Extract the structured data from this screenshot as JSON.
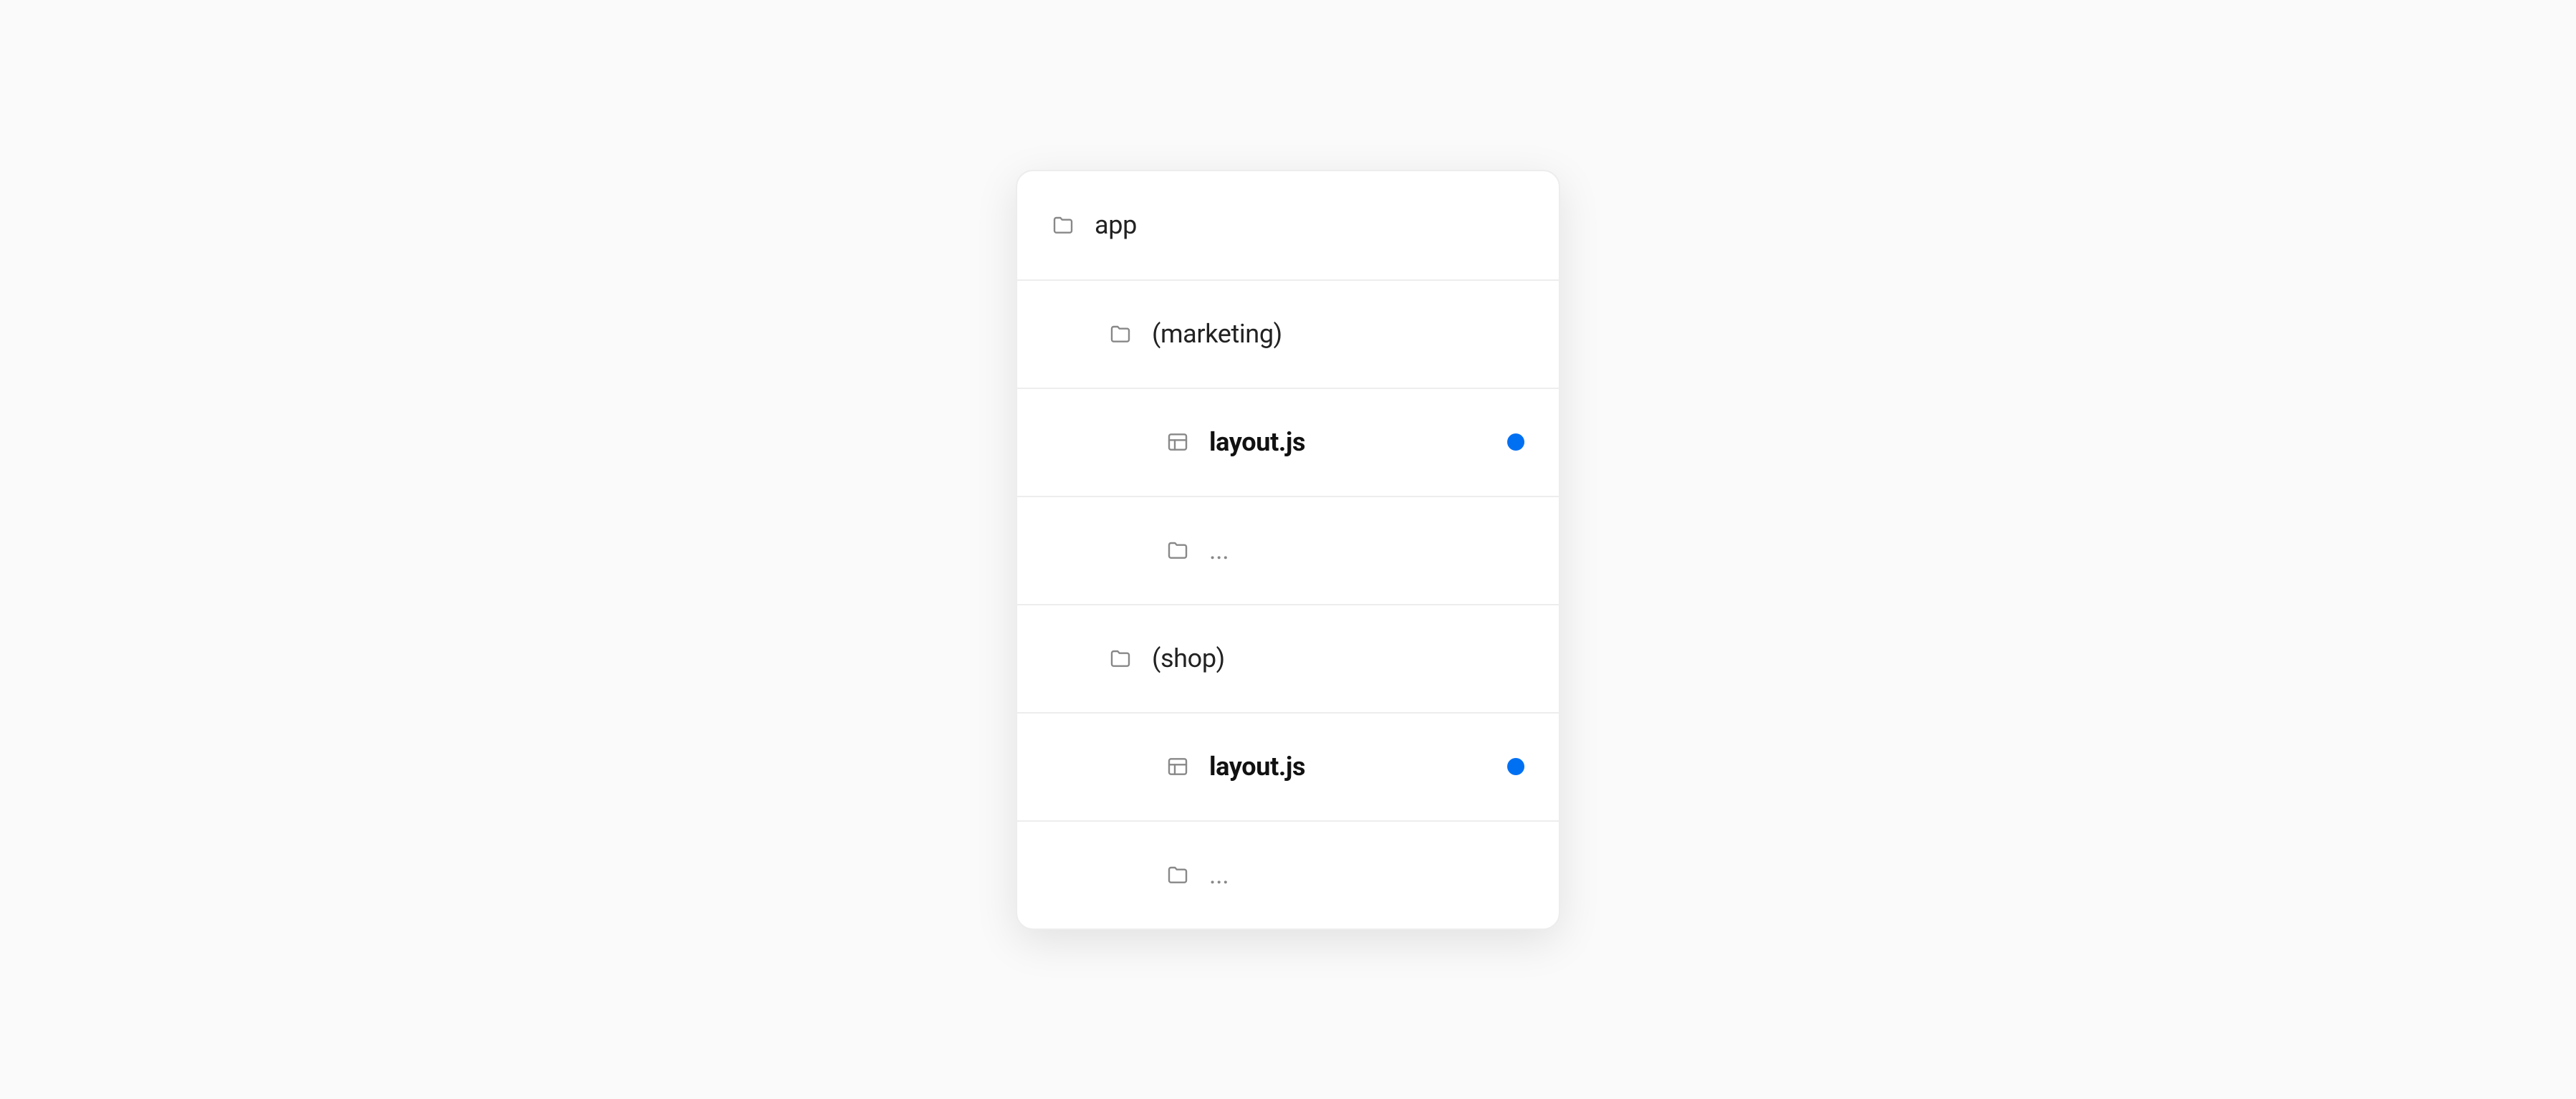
{
  "colors": {
    "dot": "#0070f3"
  },
  "rows": [
    {
      "icon": "folder",
      "label": "app",
      "indent": 0,
      "bold": false,
      "muted": false,
      "dot": false
    },
    {
      "icon": "folder",
      "label": "(marketing)",
      "indent": 1,
      "bold": false,
      "muted": false,
      "dot": false
    },
    {
      "icon": "layout",
      "label": "layout.js",
      "indent": 2,
      "bold": true,
      "muted": false,
      "dot": true
    },
    {
      "icon": "folder",
      "label": "...",
      "indent": 2,
      "bold": false,
      "muted": true,
      "dot": false
    },
    {
      "icon": "folder",
      "label": "(shop)",
      "indent": 1,
      "bold": false,
      "muted": false,
      "dot": false
    },
    {
      "icon": "layout",
      "label": "layout.js",
      "indent": 2,
      "bold": true,
      "muted": false,
      "dot": true
    },
    {
      "icon": "folder",
      "label": "...",
      "indent": 2,
      "bold": false,
      "muted": true,
      "dot": false
    }
  ]
}
